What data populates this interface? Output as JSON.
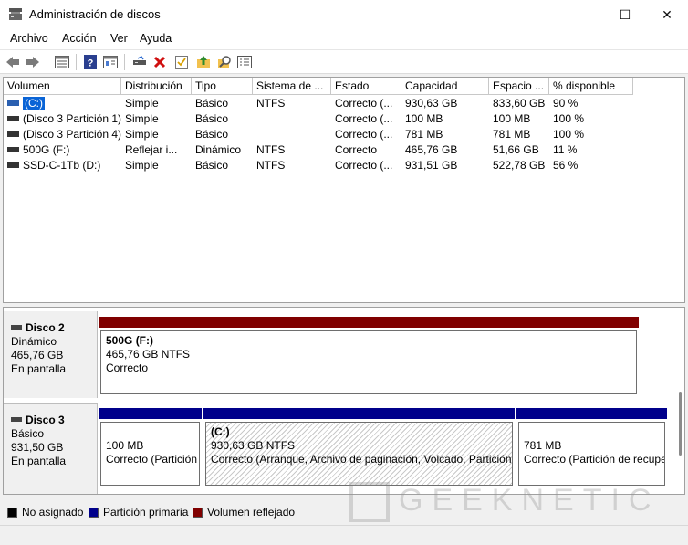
{
  "window": {
    "title": "Administración de discos"
  },
  "window_controls": {
    "minimize": "—",
    "maximize": "☐",
    "close": "✕"
  },
  "menu": [
    "Archivo",
    "Acción",
    "Ver",
    "Ayuda"
  ],
  "toolbar_icons": [
    "back-icon",
    "forward-icon",
    "properties-list-icon",
    "help-icon",
    "help-panel-icon",
    "connect-icon",
    "delete-icon",
    "check-icon",
    "folder-up-icon",
    "search-icon",
    "list-icon"
  ],
  "volumes": {
    "columns": [
      "Volumen",
      "Distribución",
      "Tipo",
      "Sistema de ...",
      "Estado",
      "Capacidad",
      "Espacio ...",
      "% disponible"
    ],
    "rows": [
      {
        "volume": "(C:)",
        "layout": "Simple",
        "type": "Básico",
        "fs": "NTFS",
        "status": "Correcto (...",
        "capacity": "930,63 GB",
        "free": "833,60 GB",
        "pct": "90 %"
      },
      {
        "volume": "(Disco 3 Partición 1)",
        "layout": "Simple",
        "type": "Básico",
        "fs": "",
        "status": "Correcto (...",
        "capacity": "100 MB",
        "free": "100 MB",
        "pct": "100 %"
      },
      {
        "volume": "(Disco 3 Partición 4)",
        "layout": "Simple",
        "type": "Básico",
        "fs": "",
        "status": "Correcto (...",
        "capacity": "781 MB",
        "free": "781 MB",
        "pct": "100 %"
      },
      {
        "volume": "500G (F:)",
        "layout": "Reflejar i...",
        "type": "Dinámico",
        "fs": "NTFS",
        "status": "Correcto",
        "capacity": "465,76 GB",
        "free": "51,66 GB",
        "pct": "11 %"
      },
      {
        "volume": "SSD-C-1Tb (D:)",
        "layout": "Simple",
        "type": "Básico",
        "fs": "NTFS",
        "status": "Correcto (...",
        "capacity": "931,51 GB",
        "free": "522,78 GB",
        "pct": "56 %"
      }
    ]
  },
  "disks": [
    {
      "name": "Disco 2",
      "kind": "Dinámico",
      "size": "465,76 GB",
      "state": "En pantalla",
      "partitions": [
        {
          "name": "500G  (F:)",
          "line1": "465,76 GB NTFS",
          "line2": "Correcto",
          "color": "#800000"
        }
      ]
    },
    {
      "name": "Disco 3",
      "kind": "Básico",
      "size": "931,50 GB",
      "state": "En pantalla",
      "partitions": [
        {
          "name": "",
          "line1": "100 MB",
          "line2": "Correcto (Partición",
          "color": "#00008b"
        },
        {
          "name": "(C:)",
          "line1": "930,63 GB NTFS",
          "line2": "Correcto (Arranque, Archivo de paginación, Volcado, Partición",
          "color": "#00008b"
        },
        {
          "name": "",
          "line1": "781 MB",
          "line2": "Correcto (Partición de recupe",
          "color": "#00008b"
        }
      ]
    }
  ],
  "legend": [
    {
      "label": "No asignado",
      "color": "#000000"
    },
    {
      "label": "Partición primaria",
      "color": "#00008b"
    },
    {
      "label": "Volumen reflejado",
      "color": "#800000"
    }
  ],
  "watermark": "GEEKNETIC"
}
